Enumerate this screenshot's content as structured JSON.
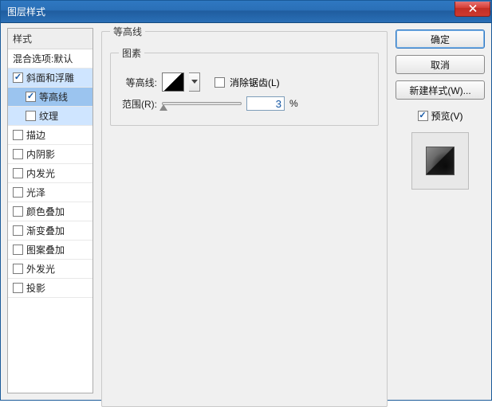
{
  "window": {
    "title": "图层样式"
  },
  "sidebar": {
    "header": "样式",
    "blend_label": "混合选项:默认",
    "items": [
      {
        "label": "斜面和浮雕",
        "checked": true,
        "indent": false,
        "state": "highlight"
      },
      {
        "label": "等高线",
        "checked": true,
        "indent": true,
        "state": "selected"
      },
      {
        "label": "纹理",
        "checked": false,
        "indent": true,
        "state": "highlight"
      },
      {
        "label": "描边",
        "checked": false,
        "indent": false,
        "state": ""
      },
      {
        "label": "内阴影",
        "checked": false,
        "indent": false,
        "state": ""
      },
      {
        "label": "内发光",
        "checked": false,
        "indent": false,
        "state": ""
      },
      {
        "label": "光泽",
        "checked": false,
        "indent": false,
        "state": ""
      },
      {
        "label": "颜色叠加",
        "checked": false,
        "indent": false,
        "state": ""
      },
      {
        "label": "渐变叠加",
        "checked": false,
        "indent": false,
        "state": ""
      },
      {
        "label": "图案叠加",
        "checked": false,
        "indent": false,
        "state": ""
      },
      {
        "label": "外发光",
        "checked": false,
        "indent": false,
        "state": ""
      },
      {
        "label": "投影",
        "checked": false,
        "indent": false,
        "state": ""
      }
    ]
  },
  "panel": {
    "outer_title": "等高线",
    "inner_title": "图素",
    "contour_label": "等高线:",
    "antialias_label": "消除锯齿(L)",
    "range_label": "范围(R):",
    "range_value": "3",
    "range_unit": "%"
  },
  "actions": {
    "ok": "确定",
    "cancel": "取消",
    "new_style": "新建样式(W)...",
    "preview_label": "预览(V)"
  }
}
